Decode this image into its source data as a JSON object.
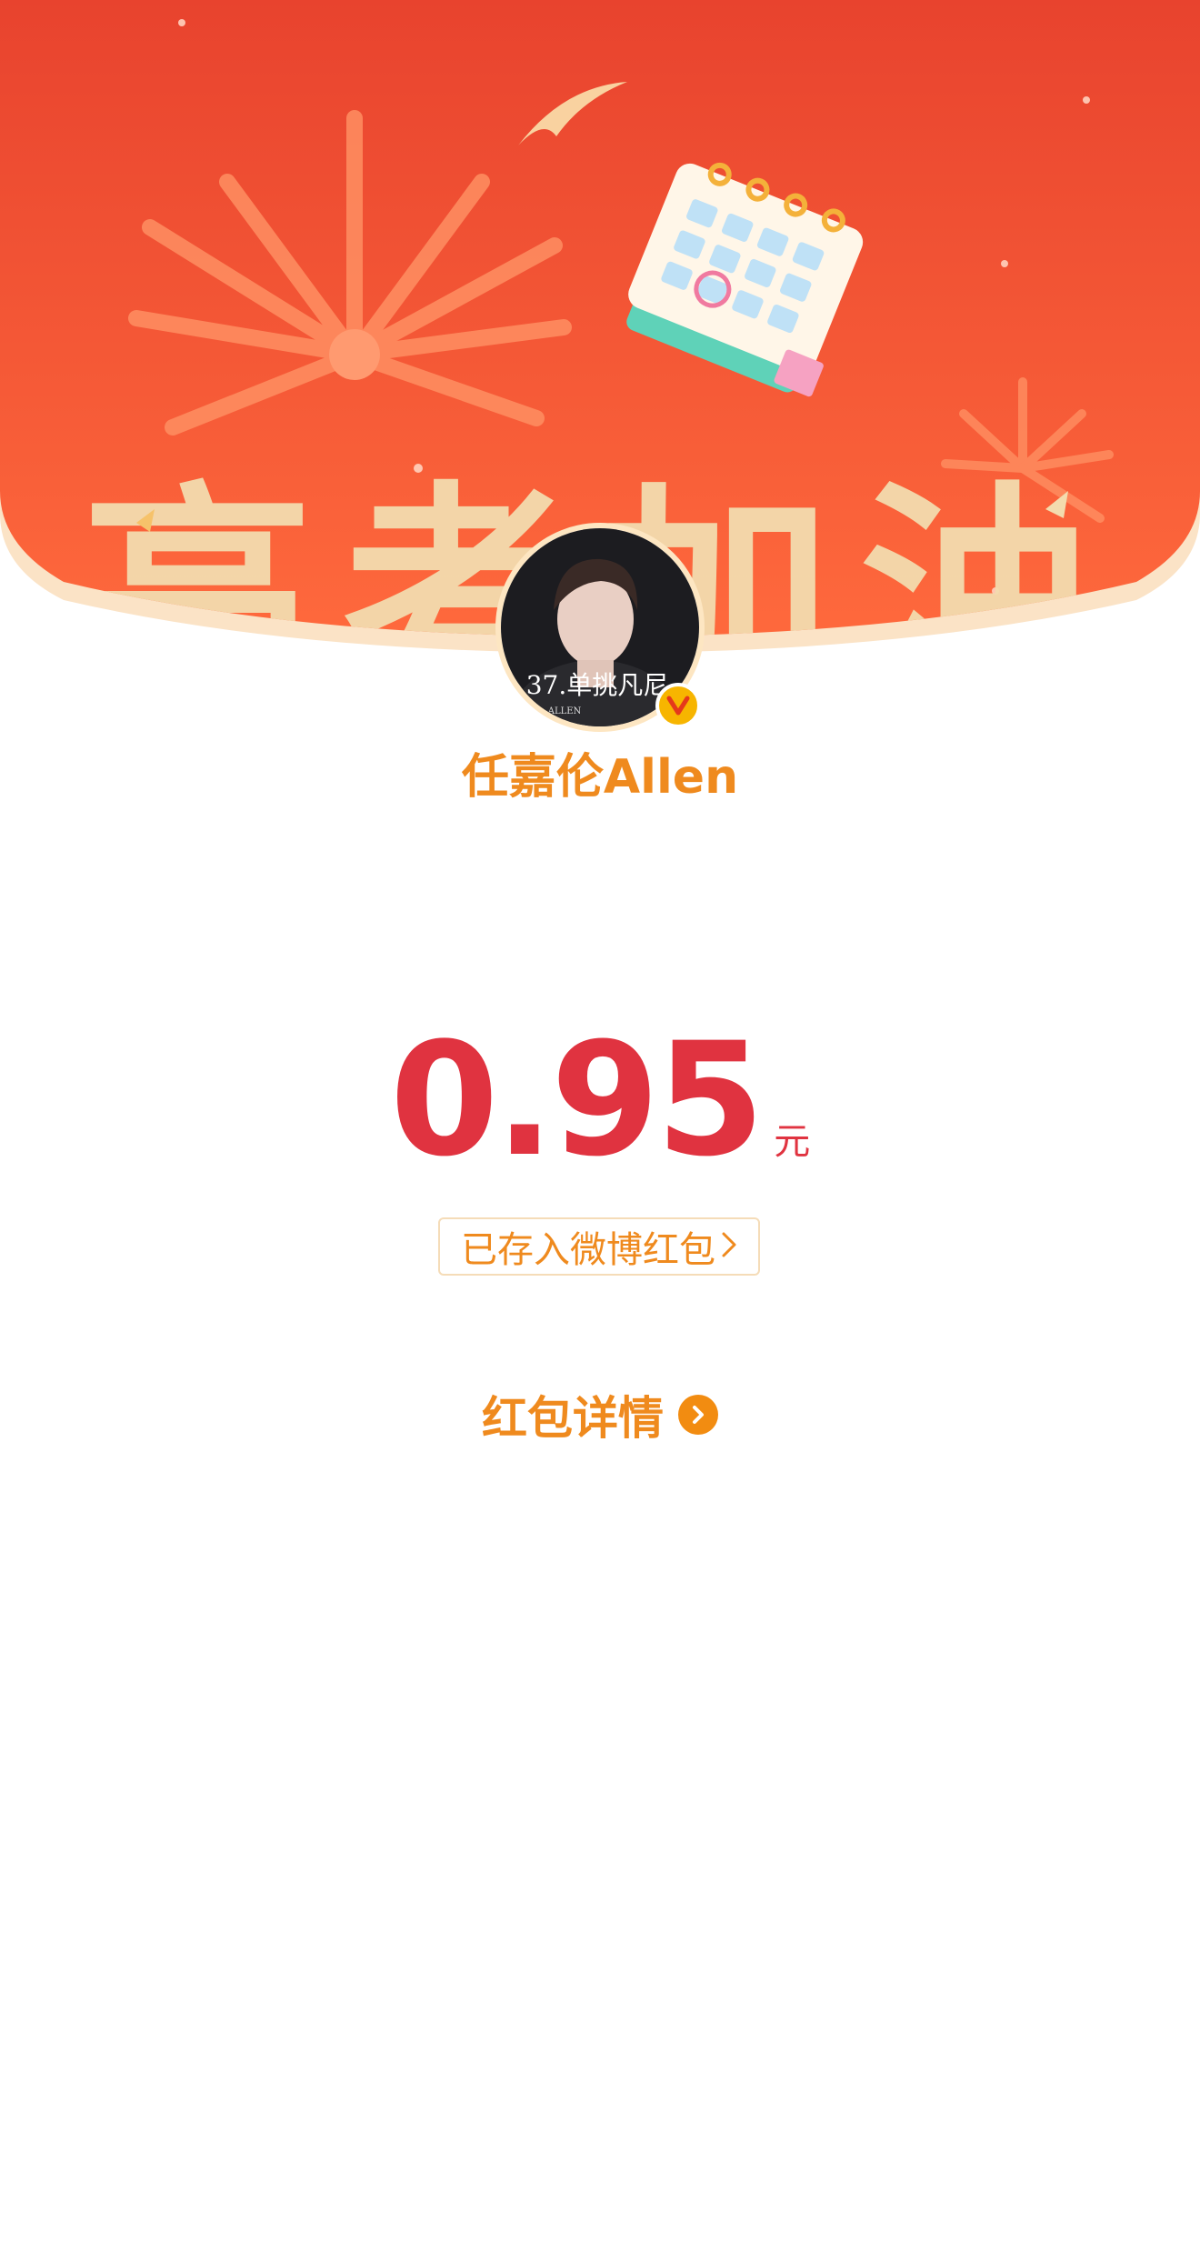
{
  "banner": {
    "slogan": "高考加油",
    "colors": {
      "top": "#e8432e",
      "bottom": "#ff6a3d",
      "rim": "#fbe3c6",
      "slogan": "#f3dcae"
    }
  },
  "sender": {
    "name": "任嘉伦Allen",
    "avatar_caption": "37.单挑凡尼",
    "avatar_subcaption": "ALLEN",
    "verified_badge": "V"
  },
  "amount": {
    "value": "0.95",
    "unit": "元",
    "color": "#e03340"
  },
  "saved_link": {
    "label": "已存入微博红包",
    "icon": "chevron-right-icon"
  },
  "details": {
    "label": "红包详情",
    "icon": "circle-chevron-right-icon",
    "accent": "#f28c11"
  }
}
